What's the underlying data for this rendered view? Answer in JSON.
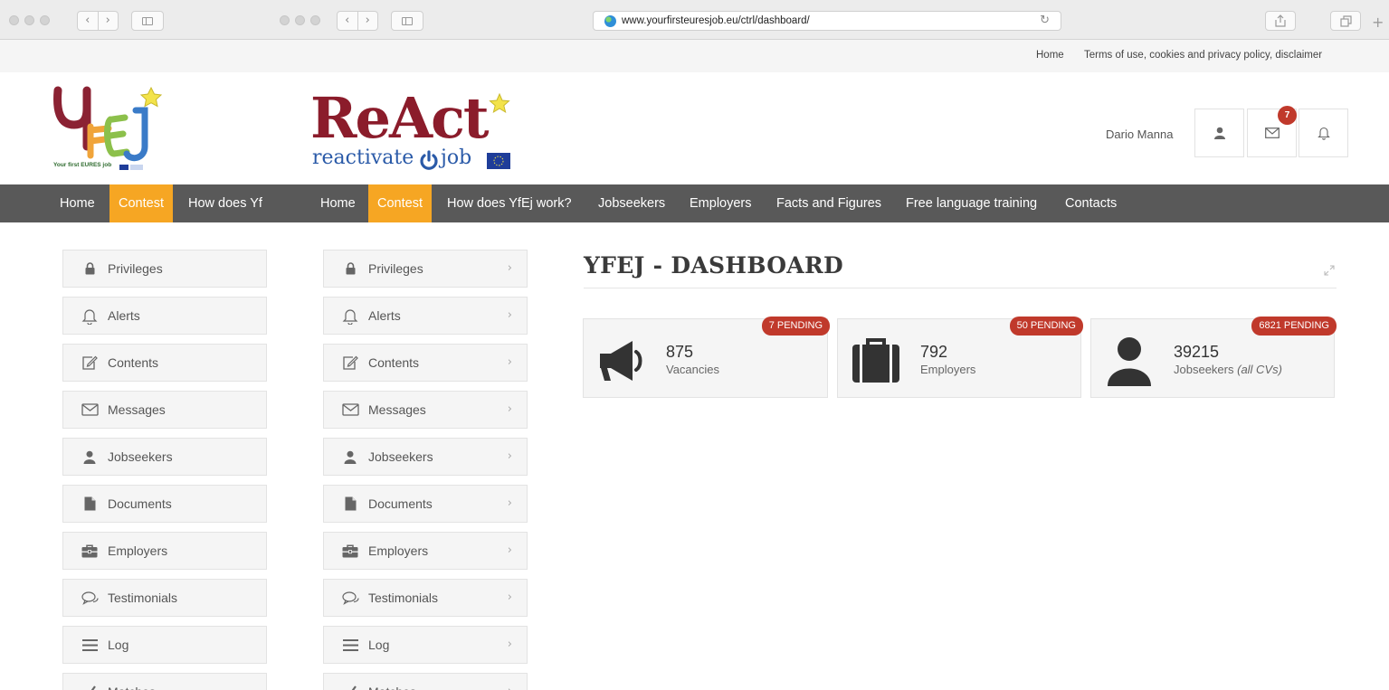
{
  "browser": {
    "url": "www.yourfirsteuresjob.eu/ctrl/dashboard/"
  },
  "top_links": [
    "Home",
    "Terms of use, cookies and privacy policy, disclaimer"
  ],
  "logos": {
    "yfej_caption": "Your first EURES job",
    "react_main": "ReAct",
    "react_sub_left": "reactivate",
    "react_sub_right": "job"
  },
  "header": {
    "user_name": "Dario Manna",
    "mail_badge": "7"
  },
  "nav_left": [
    "Home",
    "Contest",
    "How does Yf"
  ],
  "nav_main": [
    "Home",
    "Contest",
    "How does YfEj work?",
    "Jobseekers",
    "Employers",
    "Facts and Figures",
    "Free language training",
    "Contacts"
  ],
  "sidebar": [
    {
      "label": "Privileges",
      "icon": "lock-icon"
    },
    {
      "label": "Alerts",
      "icon": "bell-icon"
    },
    {
      "label": "Contents",
      "icon": "edit-icon"
    },
    {
      "label": "Messages",
      "icon": "envelope-icon"
    },
    {
      "label": "Jobseekers",
      "icon": "user-icon"
    },
    {
      "label": "Documents",
      "icon": "document-icon"
    },
    {
      "label": "Employers",
      "icon": "briefcase-icon"
    },
    {
      "label": "Testimonials",
      "icon": "chat-icon"
    },
    {
      "label": "Log",
      "icon": "list-icon"
    },
    {
      "label": "Matches",
      "icon": "check-icon"
    }
  ],
  "chevron": "›",
  "dashboard": {
    "title": "YFEJ - DASHBOARD",
    "cards": [
      {
        "badge": "7 PENDING",
        "count": "875",
        "label": "Vacancies",
        "label_extra": "",
        "icon": "megaphone-icon"
      },
      {
        "badge": "50 PENDING",
        "count": "792",
        "label": "Employers",
        "label_extra": "",
        "icon": "briefcase-icon"
      },
      {
        "badge": "6821 PENDING",
        "count": "39215",
        "label": "Jobseekers",
        "label_extra": "(all CVs)",
        "icon": "user-icon"
      }
    ]
  },
  "colors": {
    "nav_bg": "#595959",
    "nav_active": "#f6a623",
    "badge": "#c0392b",
    "react_red": "#8b1c2b",
    "react_blue": "#2a5aa8"
  }
}
